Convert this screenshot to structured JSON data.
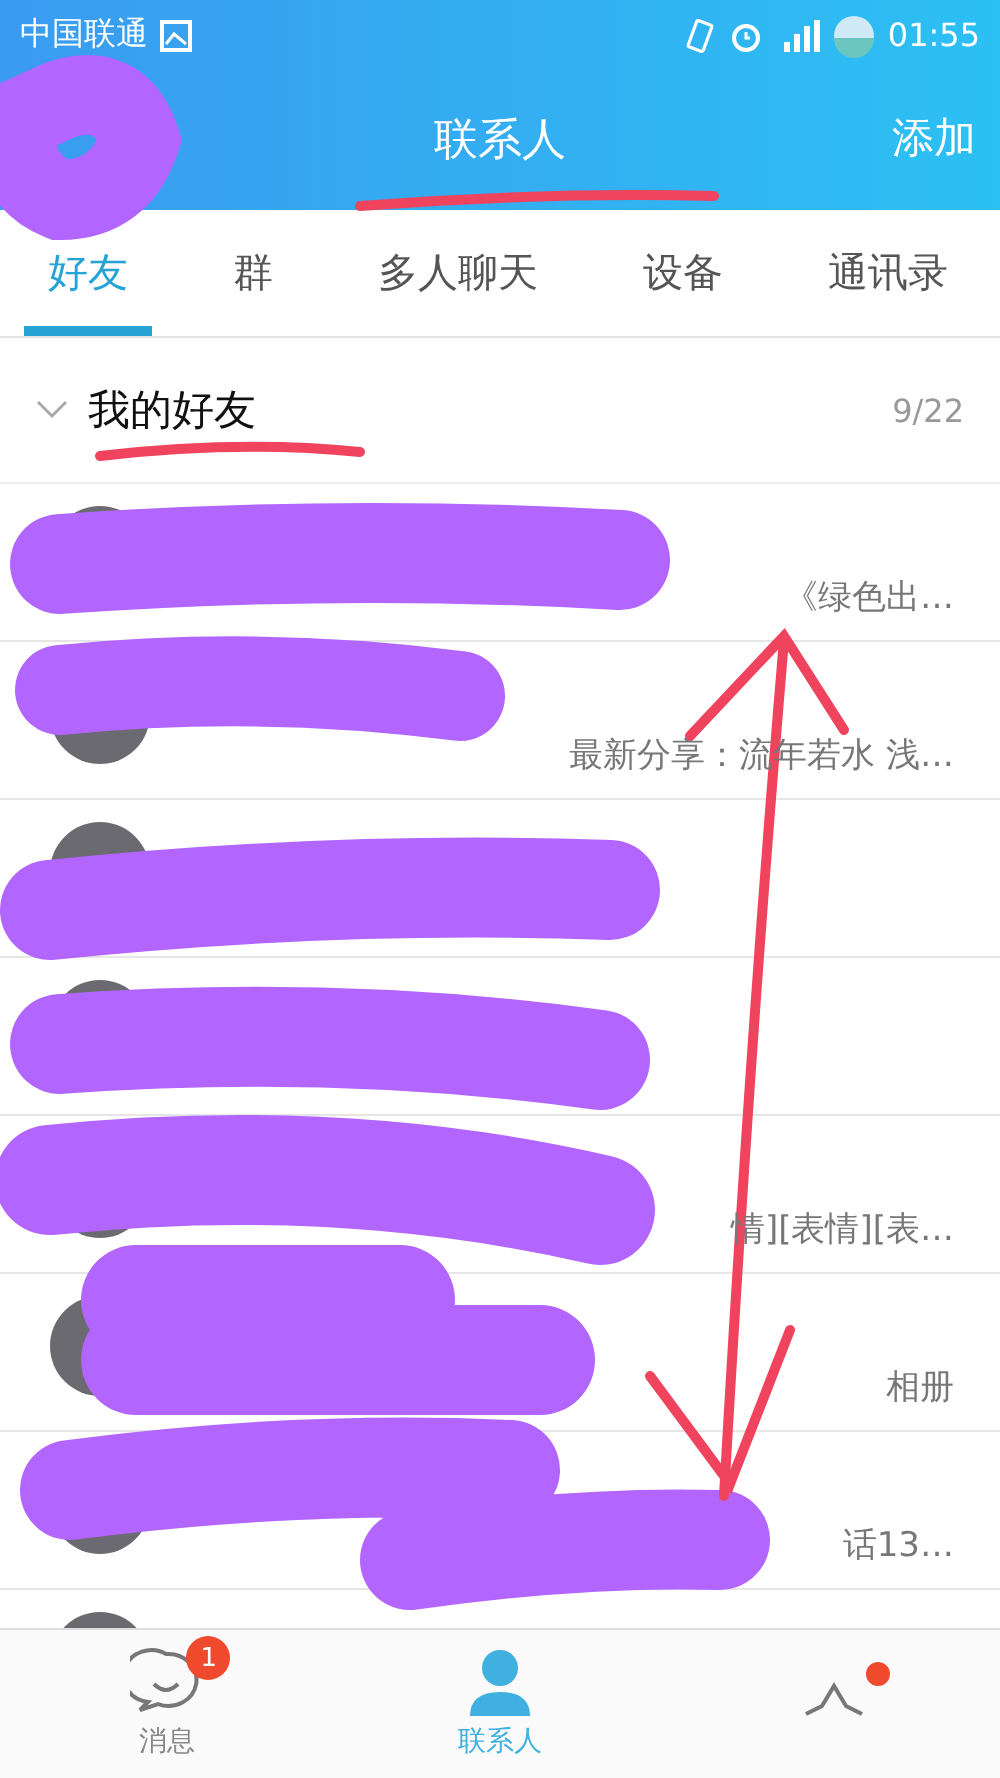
{
  "status_bar": {
    "carrier": "中国联通",
    "time": "01:55"
  },
  "header": {
    "title": "联系人",
    "action": "添加"
  },
  "tabs": [
    {
      "label": "好友",
      "selected": true
    },
    {
      "label": "群",
      "selected": false
    },
    {
      "label": "多人聊天",
      "selected": false
    },
    {
      "label": "设备",
      "selected": false
    },
    {
      "label": "通讯录",
      "selected": false
    }
  ],
  "group": {
    "name": "我的好友",
    "expanded": true,
    "count": "9/22"
  },
  "contacts": [
    {
      "kind": "snippet",
      "snippet": "《绿色出…"
    },
    {
      "kind": "snippet",
      "snippet": "最新分享：流年若水 浅…"
    },
    {
      "kind": "blank"
    },
    {
      "kind": "blank"
    },
    {
      "kind": "snippet",
      "snippet": "情][表情][表…"
    },
    {
      "kind": "snippet",
      "snippet": "相册"
    },
    {
      "kind": "snippet",
      "snippet": "话13…"
    },
    {
      "kind": "blank"
    }
  ],
  "bottom_nav": [
    {
      "kind": "messages",
      "label": "消息",
      "selected": false,
      "badge": "1"
    },
    {
      "kind": "contacts",
      "label": "联系人",
      "selected": true
    },
    {
      "kind": "moments",
      "selected": false,
      "dot": true
    }
  ]
}
